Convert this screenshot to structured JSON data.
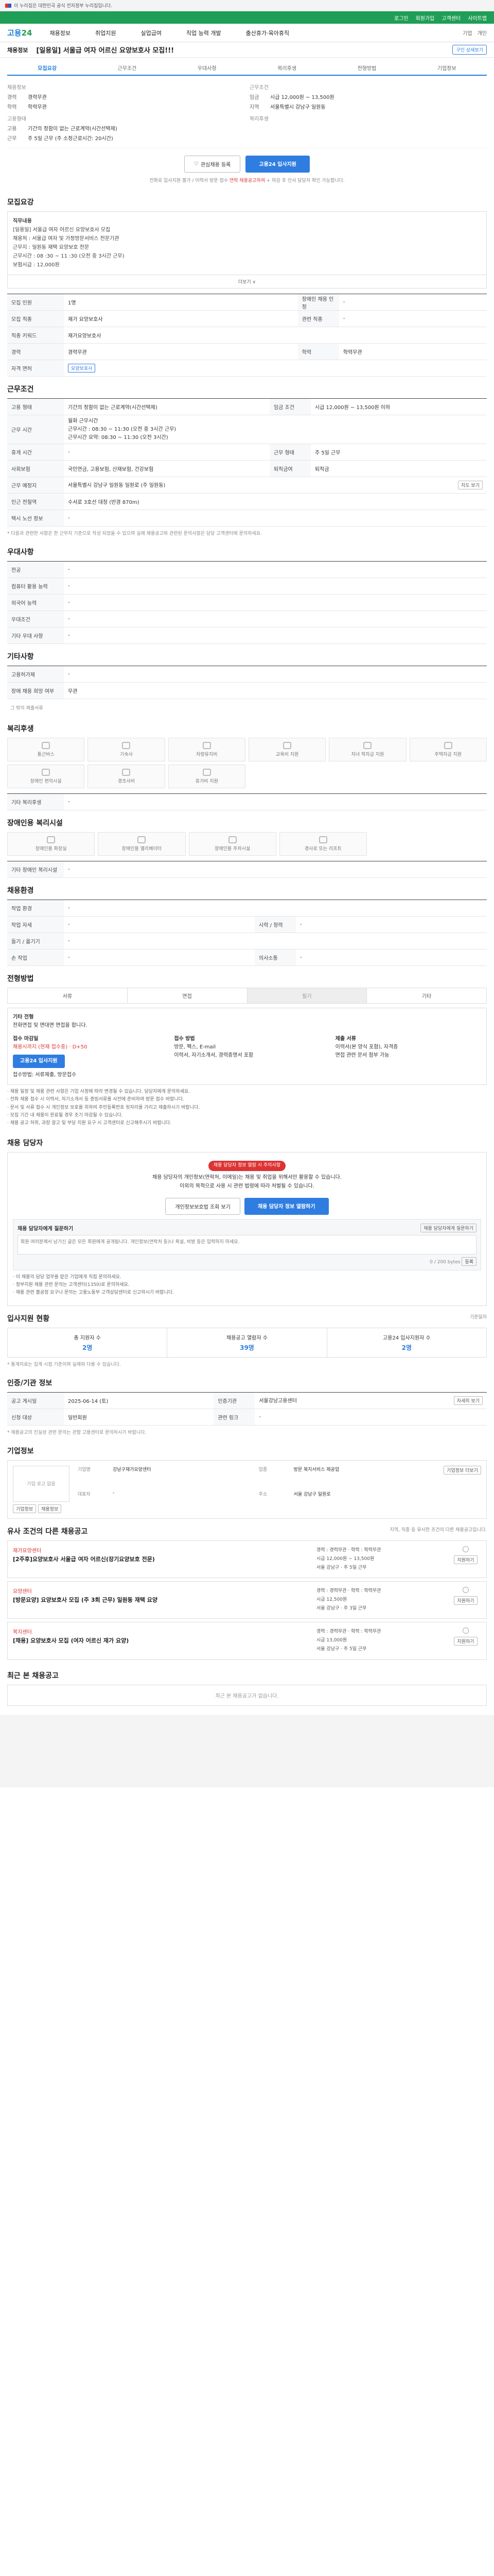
{
  "topbar": {
    "gov_text": "이 누리집은 대한민국 공식 전자정부 누리집입니다."
  },
  "greenbar": {
    "items": [
      "로그인",
      "회원가입",
      "고객센터",
      "사이트맵"
    ]
  },
  "header": {
    "logo_a": "고용",
    "logo_b": "24",
    "gnb": [
      "채용정보",
      "취업지원",
      "실업급여",
      "직업 능력 개발",
      "출산휴가·육아휴직"
    ],
    "right": [
      "기업",
      "개인"
    ]
  },
  "crumb": {
    "tag": "채용정보",
    "title": "[일용일] 서울급 여자 어르신 요양보호사 모집!!!",
    "button": "구인 상세보기"
  },
  "tabs": [
    "모집요강",
    "근무조건",
    "우대사항",
    "복리후생",
    "전형방법",
    "기업정보"
  ],
  "company": {
    "left_title": "채용정보",
    "left_rows": [
      {
        "k": "경력",
        "v": "경력무관"
      },
      {
        "k": "학력",
        "v": "학력무관"
      }
    ],
    "right_title": "근무조건",
    "right_rows": [
      {
        "k": "임금",
        "v": "시급 12,000원 ~ 13,500원"
      },
      {
        "k": "지역",
        "v": "서울특별시 강남구 일원동"
      }
    ],
    "sub_left_title": "고용형태",
    "sub_left_rows": [
      {
        "k": "고용",
        "v": "기간의 정함이 없는 근로계약(시간선택제)"
      },
      {
        "k": "근무",
        "v": "주 5일 근무 (주 소정근로시간: 20시간)"
      }
    ],
    "sub_right_title": "복리후생"
  },
  "apply": {
    "scrap": "관심채용 등록",
    "apply": "고용24 입사지원",
    "note": "전화로 입사지원 불가 / 이력서 방문 접수",
    "note_red": "연락 채용공고하여",
    "note_tail": "+ 마감 후 인사 담당자 확인 가능합니다."
  },
  "s1": {
    "title": "모집요강",
    "text": [
      "직무내용",
      "[일용일] 서울급 여자 어르신 요양보호사 모집",
      "채용처 : 서울급 여자 및 가정방문서비스 전문기관",
      "근무지 : 일원동 재택 요양보호 전문",
      "근무시간 : 08 :30 ~ 11 :30 (오전 중 3시간 근무)",
      "보험시급 : 12,000원"
    ],
    "more": "더보기 ∨",
    "rows": [
      {
        "k": "모집 인원",
        "v": "1명",
        "k2": "장애인 채용 인정",
        "v2": "-"
      },
      {
        "k": "모집 직종",
        "v": "재가 요양보호사",
        "k2": "관련 직종",
        "v2": "-"
      },
      {
        "k": "직종 키워드",
        "v": "재가요양보호사",
        "k2": "",
        "v2": ""
      },
      {
        "k": "경력",
        "v": "경력무관",
        "k2": "학력",
        "v2": "학력무관"
      },
      {
        "k": "자격 면허",
        "v": "요양보호사",
        "k2": "",
        "v2": ""
      }
    ]
  },
  "s2": {
    "title": "근무조건",
    "rows": [
      {
        "k": "고용 형태",
        "v": "기간의 정함이 없는 근로계약(시간선택제)",
        "k2": "임금 조건",
        "v2": "시급 12,000원 ~ 13,500원 이하"
      },
      {
        "k": "근무 시간",
        "v": "월화 근무시간\n근무시간 : 08:30 ~ 11:30 (오전 중 3시간 근무)\n근무시간 요약: 08:30 ~ 11:30 (오전 3시간)",
        "k2": "",
        "v2": ""
      },
      {
        "k": "휴게 시간",
        "v": "-",
        "k2": "근무 형태",
        "v2": "주 5일 근무"
      },
      {
        "k": "사회보험",
        "v": "국민연금, 고용보험, 산재보험, 건강보험",
        "k2": "퇴직금여",
        "v2": "퇴직금"
      },
      {
        "k": "근무 예정지",
        "v": "서울특별시 강남구 일원동 일원로 (주 일원동)",
        "k2": "",
        "v2": ""
      },
      {
        "k": "인근 전철역",
        "v": "수서로 3호선 대청 (반경 870m)",
        "k2": "",
        "v2": ""
      },
      {
        "k": "택시 노선 정보",
        "v": "-",
        "k2": "",
        "v2": ""
      }
    ],
    "map_btn": "지도 보기",
    "footnote": "* 다음과 관련한 사항은 한 근무지 기준으로 작성 되었을 수 있으며 실제 채용공고와 관련된 문의사항은 담당 고객센터에 문의하세요."
  },
  "s3": {
    "title": "우대사항",
    "rows": [
      {
        "k": "전공",
        "v": "-"
      },
      {
        "k": "컴퓨터 활용 능력",
        "v": "-"
      },
      {
        "k": "외국어 능력",
        "v": "-"
      },
      {
        "k": "우대조건",
        "v": "-"
      },
      {
        "k": "기타 우대 사항",
        "v": "-"
      }
    ]
  },
  "s4": {
    "title": "기타사항",
    "rows": [
      {
        "k": "고용허가제",
        "v": "-"
      },
      {
        "k": "장애 채용 희망 여부",
        "v": "무관"
      }
    ],
    "extra": "그 밖의 제출서류"
  },
  "s5": {
    "title": "복리후생",
    "cards": [
      "통근버스",
      "기숙사",
      "차량유지비",
      "교육비 지원",
      "자녀 학자금 지원",
      "주택자금 지원",
      "장애인 편의시설",
      "경조사비",
      "휴가비 지원"
    ],
    "other_label": "기타 복리후생",
    "other_value": "-"
  },
  "s6": {
    "title": "장애인용 복리시설",
    "cards": [
      "장애인용 화장실",
      "장애인용 엘리베이터",
      "장애인용 주차시설",
      "경사로 또는 리프트"
    ],
    "other_label": "기타 장애인 복리시설",
    "other_value": "-"
  },
  "s7": {
    "title": "채용환경",
    "rows": [
      {
        "k": "작업 환경",
        "v": "-",
        "k2": "",
        "v2": ""
      },
      {
        "k": "작업 자세",
        "v": "-",
        "k2": "시력 / 청력",
        "v2": "-"
      },
      {
        "k": "들기 / 옮기기",
        "v": "-",
        "k2": "",
        "v2": ""
      },
      {
        "k": "손 작업",
        "v": "-",
        "k2": "의사소통",
        "v2": "-"
      }
    ]
  },
  "s8": {
    "title": "전형방법",
    "seg": [
      "서류",
      "면접",
      "필기",
      "기타"
    ],
    "box_lead": "기타 전형",
    "box_text": "전화면접 및 면대면 면접을 합니다.",
    "cols": [
      {
        "h": "접수 마감일",
        "lines": [
          "채용시까지 (현재 접수중) · D+50",
          "고용24 입사지원",
          "접수방법: 서류제출, 방문접수"
        ],
        "btn": "고용24 입사지원"
      },
      {
        "h": "접수 방법",
        "lines": [
          "방문, 팩스, E-mail",
          "이력서, 자기소개서, 경력증명서 포함"
        ],
        "btn": ""
      },
      {
        "h": "제출 서류",
        "lines": [
          "이력서(본 양식 포함), 자격증",
          "면접 관련 문서 첨부 가능"
        ],
        "btn": ""
      }
    ],
    "bullets": [
      "· 채용 일정 및 채용 관련 사항은 기업 사정에 따라 변경될 수 있습니다. 담당자에게 문의하세요.",
      "· 전화 채용 접수 시 이력서, 자기소개서 등 증빙서류를 사전에 준비하여 방문 접수 바랍니다.",
      "· 문서 및 서류 접수 시 개인정보 보호를 위하여 주민등록번호 뒷자리를 가리고 제출하시기 바랍니다.",
      "· 모집 기간 내 채용이 완료될 경우 조기 마감될 수 있습니다.",
      "· 채용 공고 허위, 과장 광고 및 부당 지원 요구 시 고객센터로 신고해주시기 바랍니다."
    ]
  },
  "s9": {
    "title": "채용 담당자",
    "badge": "채용 담당자 정보 열람 시 주의사항",
    "lines": [
      "채용 담당자의 개인정보(연락처, 이메일)는 채용 및 취업을 위해서만 활용할 수 있습니다.",
      "이외의 목적으로 사용 시 관련 법령에 따라 처벌될 수 있습니다."
    ],
    "btn_a": "개인정보보호법 조회 보기",
    "btn_b": "채용 담당자 정보 열람하기",
    "q_title": "채용 담당자에게 질문하기",
    "q_btn": "채용 담당자에게 질문하기",
    "q_placeholder": "회원 여러분께서 남기신 글은 모든 회원에게 공개됩니다. 개인정보(연락처 등)나 욕설, 비방 등은 입력하지 마세요.",
    "q_count": "0 / 200 bytes",
    "q_submit": "등록",
    "notes": [
      "· 이 채용의 담당 업무를 맡은 기업에게 직접 문의하세요.",
      "· 정부지원 채용 관련 문의는 고객센터(1350)로 문의하세요.",
      "· 채용 관련 불공정 요구나 문의는 고용노동부 고객상담센터로 신고하시기 바랍니다."
    ]
  },
  "s10": {
    "title": "입사지원 현황",
    "updated": "기준일자",
    "cells": [
      {
        "h": "총 지원자 수",
        "v": "2명"
      },
      {
        "h": "채용공고 열람자 수",
        "v": "39명"
      },
      {
        "h": "고용24 입사지원자 수",
        "v": "2명"
      }
    ],
    "note": "* 통계자료는 집계 시점 기준이며 실제와 다를 수 있습니다."
  },
  "s11": {
    "title": "인증/기관 정보",
    "rows": [
      {
        "k": "공고 게시일",
        "v": "2025-06-14 (토)",
        "k2": "인증기관",
        "v2": "서울강남고용센터",
        "btn": "자세히 보기"
      },
      {
        "k": "신청 대상",
        "v": "일반회원",
        "k2": "관련 링크",
        "v2": "-",
        "btn": ""
      }
    ],
    "note": "* 채용공고의 진실성 관련 문의는 관할 고용센터로 문의하시기 바랍니다."
  },
  "s12": {
    "title": "기업정보",
    "logo": "기업 로고 없음",
    "btns": [
      "기업정보",
      "채용정보"
    ],
    "info": [
      {
        "k": "기업명",
        "v": "강남구재가요양센터"
      },
      {
        "k": "업종",
        "v": "방문 복지서비스 제공업"
      },
      {
        "k": "대표자",
        "v": "-"
      },
      {
        "k": "주소",
        "v": "서울 강남구 일원로"
      }
    ],
    "detail_btn": "기업정보 더보기"
  },
  "s13": {
    "title": "유사 조건의 다른 채용공고",
    "desc": "지역, 직종 등 유사한 조건의 다른 채용공고입니다.",
    "cards": [
      {
        "co": "재가요양센터",
        "title": "[2주후]요양보호사 서울급 여자 어르신(장기요양보호 전문)",
        "mid": [
          "경력 : 경력무관 · 학력 : 학력무관",
          "시급 12,000원 ~ 13,500원",
          "서울 강남구 · 주 5일 근무"
        ],
        "apply": "지원하기"
      },
      {
        "co": "요양센터",
        "title": "[방문요양] 요양보호사 모집 (주 3회 근무) 일원동 재택 요양",
        "mid": [
          "경력 : 경력무관 · 학력 : 학력무관",
          "시급 12,500원",
          "서울 강남구 · 주 3일 근무"
        ],
        "apply": "지원하기"
      },
      {
        "co": "복지센터",
        "title": "[채용] 요양보호사 모집 (여자 어르신 재가 요양)",
        "mid": [
          "경력 : 경력무관 · 학력 : 학력무관",
          "시급 13,000원",
          "서울 강남구 · 주 5일 근무"
        ],
        "apply": "지원하기"
      }
    ]
  },
  "s14": {
    "title": "최근 본 채용공고",
    "empty": "최근 본 채용공고가 없습니다."
  }
}
